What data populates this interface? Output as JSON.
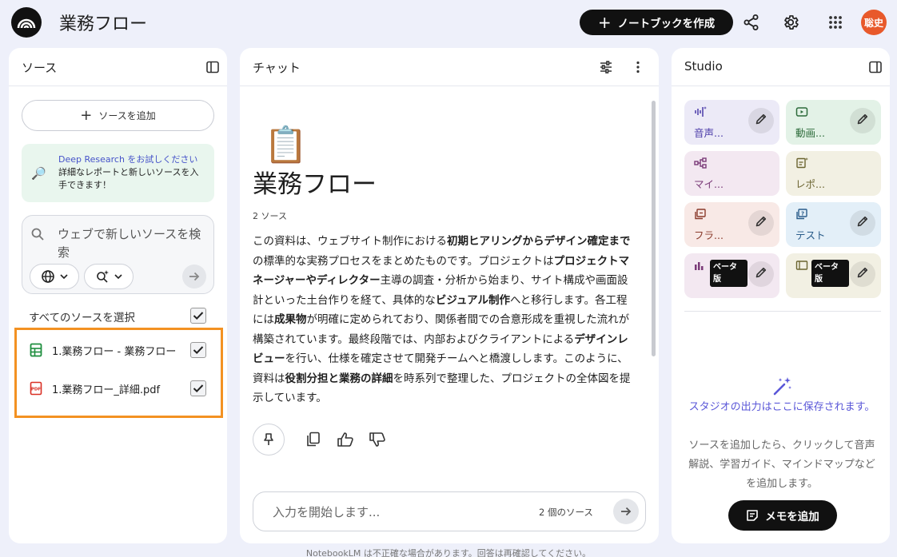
{
  "header": {
    "logo_icon": "notebooklm-logo-icon",
    "title": "業務フロー",
    "create_button": "ノートブックを作成",
    "share_icon": "share-icon",
    "settings_icon": "gear-icon",
    "apps_icon": "apps-grid-icon",
    "avatar_text": "聡史"
  },
  "sources": {
    "title": "ソース",
    "add_button": "ソースを追加",
    "deep_research": {
      "link_text": "Deep Research をお試しください",
      "body": "詳細なレポートと新しいソースを入手できます！"
    },
    "web_search": {
      "placeholder": "ウェブで新しいソースを検索",
      "web_icon": "globe-icon",
      "research_icon": "sparkle-search-icon"
    },
    "select_all_label": "すべてのソースを選択",
    "select_all_checked": true,
    "items": [
      {
        "name": "1.業務フロー - 業務フロー",
        "icon": "google-sheets-icon",
        "checked": true
      },
      {
        "name": "1.業務フロー_詳細.pdf",
        "icon": "pdf-icon",
        "checked": true
      }
    ]
  },
  "chat": {
    "title": "チャット",
    "notebook_emoji": "📋",
    "notebook_title": "業務フロー",
    "source_count": "2 ソース",
    "summary_segments": [
      {
        "text": "この資料は、ウェブサイト制作における",
        "bold": false
      },
      {
        "text": "初期ヒアリングからデザイン確定まで",
        "bold": true
      },
      {
        "text": "の標準的な実務プロセスをまとめたものです。プロジェクトは",
        "bold": false
      },
      {
        "text": "プロジェクトマネージャーやディレクター",
        "bold": true
      },
      {
        "text": "主導の調査・分析から始まり、サイト構成や画面設計といった土台作りを経て、具体的な",
        "bold": false
      },
      {
        "text": "ビジュアル制作",
        "bold": true
      },
      {
        "text": "へと移行します。各工程には",
        "bold": false
      },
      {
        "text": "成果物",
        "bold": true
      },
      {
        "text": "が明確に定められており、関係者間での合意形成を重視した流れが構築されています。最終段階では、内部およびクライアントによる",
        "bold": false
      },
      {
        "text": "デザインレビュー",
        "bold": true
      },
      {
        "text": "を行い、仕様を確定させて開発チームへと橋渡しします。このように、資料は",
        "bold": false
      },
      {
        "text": "役割分担と業務の詳細",
        "bold": true
      },
      {
        "text": "を時系列で整理した、プロジェクトの全体図を提示しています。",
        "bold": false
      }
    ],
    "input_placeholder": "入力を開始します...",
    "input_source_count": "2 個のソース"
  },
  "studio": {
    "title": "Studio",
    "tiles": [
      {
        "label": "音声...",
        "icon": "audio-waveform-icon",
        "bg": "#eceaf7",
        "fg": "#4a3aa8",
        "beta": false
      },
      {
        "label": "動画...",
        "icon": "video-icon",
        "bg": "#e3f2e7",
        "fg": "#2c6b3a",
        "beta": false
      },
      {
        "label": "マイ...",
        "icon": "mindmap-icon",
        "bg": "#f3e8f1",
        "fg": "#7a3a78",
        "beta": false
      },
      {
        "label": "レポ...",
        "icon": "report-icon",
        "bg": "#f2f0e3",
        "fg": "#6b6430",
        "beta": false
      },
      {
        "label": "フラ...",
        "icon": "flashcard-icon",
        "bg": "#f8e9e6",
        "fg": "#8a3b2c",
        "beta": false
      },
      {
        "label": "テスト",
        "icon": "quiz-icon",
        "bg": "#e3eff8",
        "fg": "#2a5c8a",
        "beta": false
      },
      {
        "label": "",
        "icon": "infographic-icon",
        "bg": "#f3e8f1",
        "fg": "#7a3a78",
        "beta": true
      },
      {
        "label": "",
        "icon": "slides-icon",
        "bg": "#f2f0e3",
        "fg": "#6b6430",
        "beta": true
      }
    ],
    "beta_label": "ベータ版",
    "empty_title": "スタジオの出力はここに保存されます。",
    "empty_body": "ソースを追加したら、クリックして音声解説、学習ガイド、マインドマップなどを追加します。",
    "memo_button": "メモを追加"
  },
  "footer": "NotebookLM は不正確な場合があります。回答は再確認してください。"
}
